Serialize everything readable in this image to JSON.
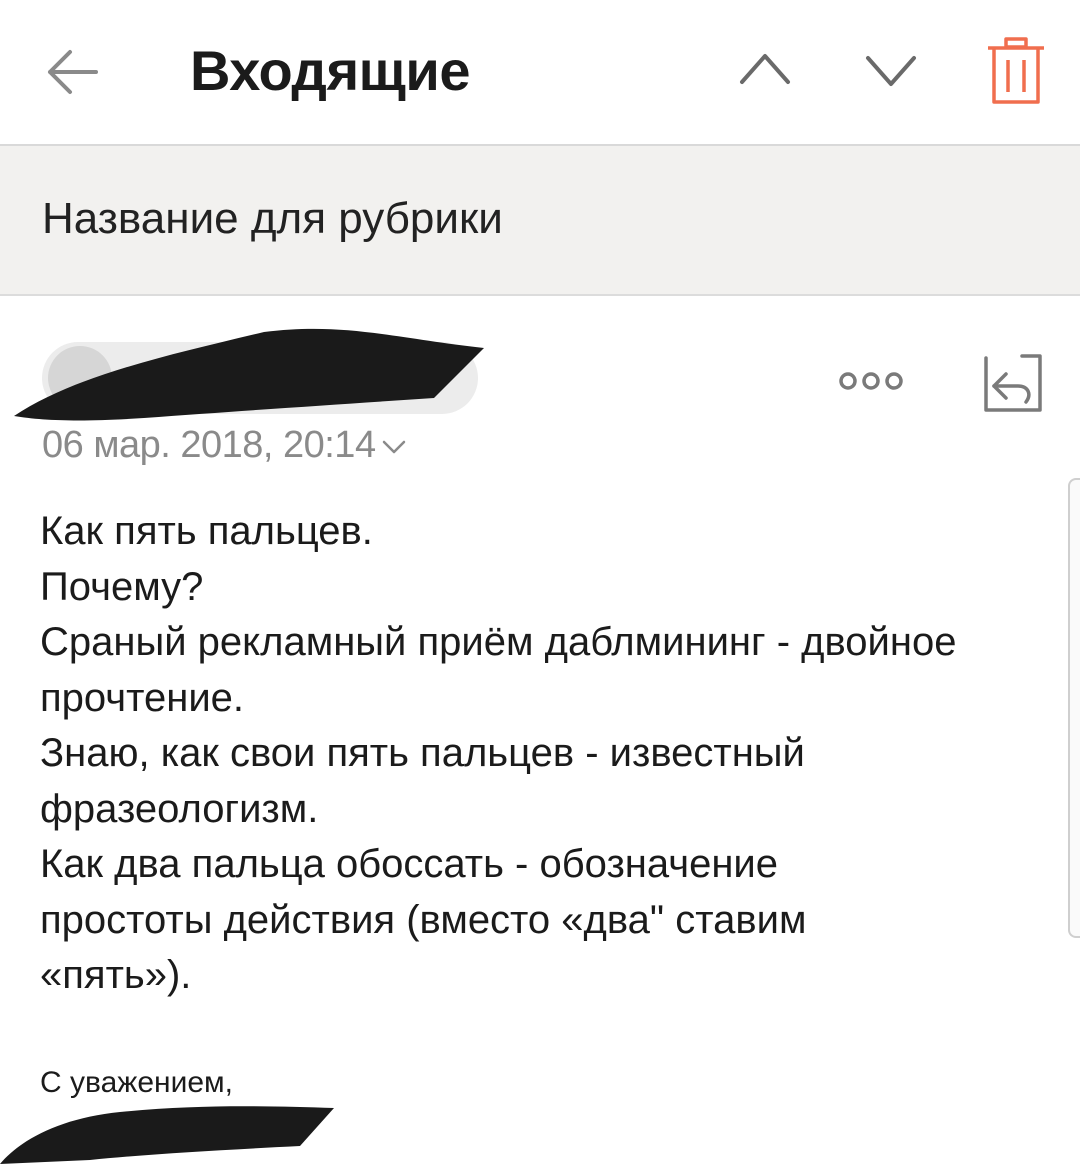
{
  "header": {
    "title": "Входящие",
    "back_icon": "arrow-left-icon",
    "prev_icon": "chevron-up-icon",
    "next_icon": "chevron-down-icon",
    "delete_icon": "trash-icon",
    "accent_color": "#f06e4e"
  },
  "message": {
    "subject": "Название для рубрики",
    "date": "06 мар. 2018, 20:14",
    "more_icon": "more-dots-icon",
    "reply_icon": "reply-icon",
    "body_lines": [
      "Как пять пальцев.",
      "Почему?",
      "Сраный рекламный приём даблмининг - двойное",
      "прочтение.",
      "Знаю, как свои пять пальцев - известный",
      "фразеологизм.",
      "Как два пальца обоссать - обозначение",
      "простоты действия (вместо «два\" ставим",
      "«пять»)."
    ],
    "signature": "С уважением,"
  },
  "colors": {
    "subject_bar_bg": "#f2f1ef",
    "date_text": "#8a8a8a",
    "redaction": "#1a1a1a"
  }
}
